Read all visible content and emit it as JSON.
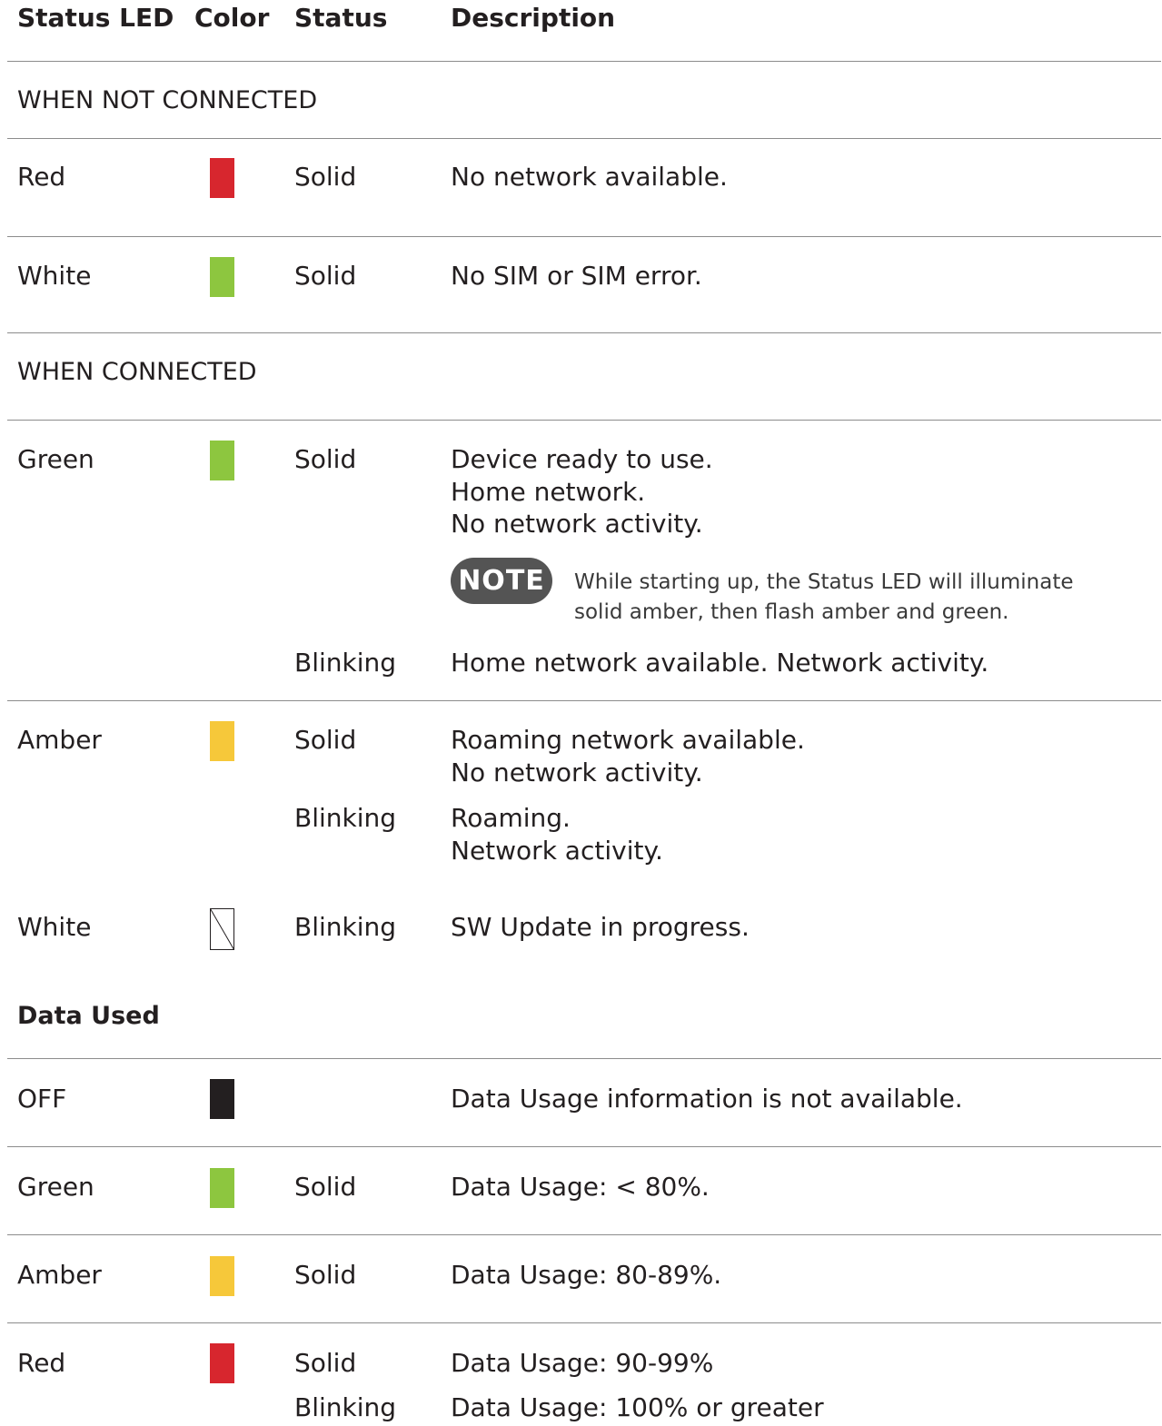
{
  "header": {
    "col_led": "Status LED",
    "col_color": "Color",
    "col_status": "Status",
    "col_desc": "Description"
  },
  "sections": {
    "not_connected": "WHEN NOT CONNECTED",
    "connected": "WHEN CONNECTED",
    "data_used": "Data Used"
  },
  "colors": {
    "red": "#d7262e",
    "green": "#8dc63f",
    "amber": "#f6c83a",
    "black": "#231f20"
  },
  "rows": {
    "nc_red": {
      "led": "Red",
      "status": "Solid",
      "desc": "No network available."
    },
    "nc_white": {
      "led": "White",
      "status": "Solid",
      "desc": "No SIM or SIM error."
    },
    "c_green": {
      "led": "Green",
      "status": "Solid",
      "desc": "Device ready to use.\nHome network.\nNo network activity.",
      "status2": "Blinking",
      "desc2": "Home network available. Network activity."
    },
    "c_amber": {
      "led": "Amber",
      "status": "Solid",
      "desc": "Roaming network available.\nNo network activity.",
      "status2": "Blinking",
      "desc2": "Roaming.\nNetwork activity."
    },
    "c_white": {
      "led": "White",
      "status": "Blinking",
      "desc": "SW Update in progress."
    },
    "d_off": {
      "led": "OFF",
      "desc": "Data Usage information is not available."
    },
    "d_green": {
      "led": "Green",
      "status": "Solid",
      "desc": "Data Usage:  < 80%."
    },
    "d_amber": {
      "led": "Amber",
      "status": "Solid",
      "desc": "Data Usage:  80-89%."
    },
    "d_red": {
      "led": "Red",
      "status": "Solid",
      "desc": "Data Usage:  90-99%",
      "status2": "Blinking",
      "desc2": "Data Usage:  100% or greater"
    }
  },
  "note": {
    "badge": "NOTE",
    "text": "While starting up, the Status LED will illuminate\nsolid amber, then flash amber and green."
  }
}
